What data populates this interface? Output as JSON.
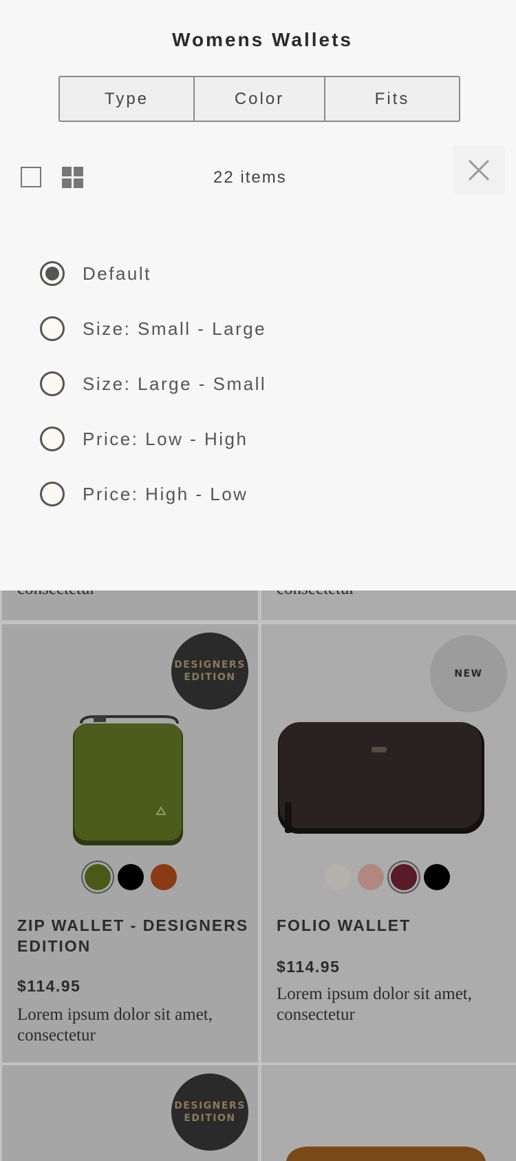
{
  "panel": {
    "title": "Womens Wallets",
    "tabs": [
      "Type",
      "Color",
      "Fits"
    ],
    "item_count": "22 items",
    "sort_options": [
      {
        "label": "Default",
        "selected": true
      },
      {
        "label": "Size: Small - Large",
        "selected": false
      },
      {
        "label": "Size: Large - Small",
        "selected": false
      },
      {
        "label": "Price: Low - High",
        "selected": false
      },
      {
        "label": "Price: High - Low",
        "selected": false
      }
    ]
  },
  "background_products": {
    "top_row_desc_fragment": "consectetur",
    "products": [
      {
        "badge": "DESIGNERS EDITION",
        "name": "ZIP WALLET - DESIGNERS EDITION",
        "price": "$114.95",
        "desc": "Lorem ipsum dolor sit amet, consectetur",
        "swatches": [
          "#4a5a16",
          "#000000",
          "#8a3a14"
        ],
        "selected_swatch": 0
      },
      {
        "badge": "NEW",
        "name": "FOLIO WALLET",
        "price": "$114.95",
        "desc": "Lorem ipsum dolor sit amet, consectetur",
        "swatches": [
          "#b4b0aa",
          "#b08880",
          "#5a1a26",
          "#000000"
        ],
        "selected_swatch": 2
      }
    ],
    "bottom_row_badge": "DESIGNERS EDITION"
  },
  "colors": {
    "panel_bg": "#f7f7f7",
    "overlay_dim": "#a6a6a6",
    "badge_dark": "#2a2a2a",
    "badge_gold": "#8a7a58"
  }
}
